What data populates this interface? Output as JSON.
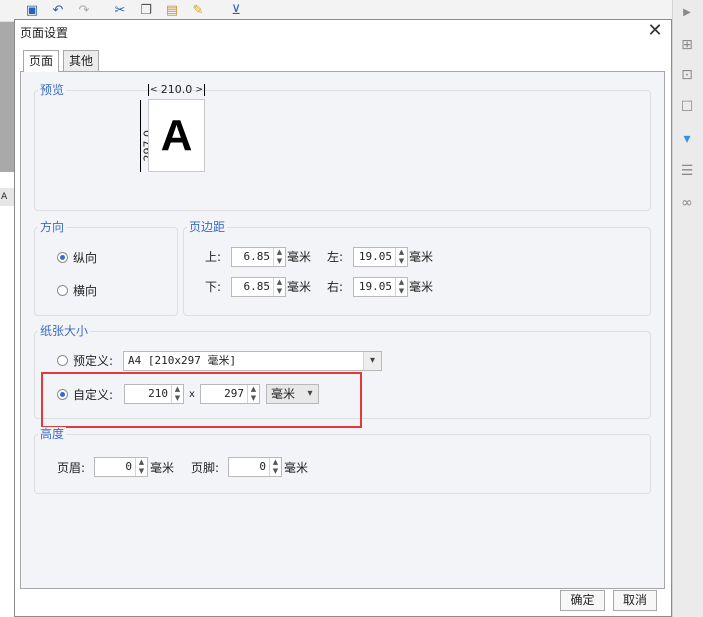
{
  "dialog": {
    "title": "页面设置",
    "close_glyph": "✕",
    "tabs": [
      {
        "label": "页面",
        "active": true
      },
      {
        "label": "其他",
        "active": false
      }
    ]
  },
  "preview": {
    "legend": "预览",
    "width_label": "210.0",
    "height_label": "297.0",
    "letter": "A"
  },
  "orientation": {
    "legend": "方向",
    "portrait_label": "纵向",
    "landscape_label": "横向",
    "selected": "portrait"
  },
  "margins": {
    "legend": "页边距",
    "top_label": "上:",
    "top_value": "6.85",
    "bottom_label": "下:",
    "bottom_value": "6.85",
    "left_label": "左:",
    "left_value": "19.05",
    "right_label": "右:",
    "right_value": "19.05",
    "unit": "毫米"
  },
  "paper_size": {
    "legend": "纸张大小",
    "predefined_label": "预定义:",
    "predefined_value": "A4 [210x297 毫米]",
    "custom_label": "自定义:",
    "custom_width": "210",
    "times": "x",
    "custom_height": "297",
    "custom_unit": "毫米",
    "selected": "custom"
  },
  "height": {
    "legend": "高度",
    "header_label": "页眉:",
    "header_value": "0",
    "footer_label": "页脚:",
    "footer_value": "0",
    "unit": "毫米"
  },
  "buttons": {
    "ok": "确定",
    "cancel": "取消"
  },
  "icons": {
    "toolbar": [
      "save-icon",
      "undo-icon",
      "redo-icon",
      "cut-icon",
      "copy-icon",
      "paste-icon",
      "format-painter-icon",
      "insert-icon"
    ],
    "right_panel": [
      "expand-arrow-icon",
      "cell-icon",
      "element-icon",
      "border-icon",
      "dropdown-widget-icon",
      "layout-icon",
      "link-icon"
    ]
  },
  "background": {
    "cell_label": "A"
  },
  "colors": {
    "accent": "#3a6cc6",
    "highlight": "#e23a3a"
  }
}
